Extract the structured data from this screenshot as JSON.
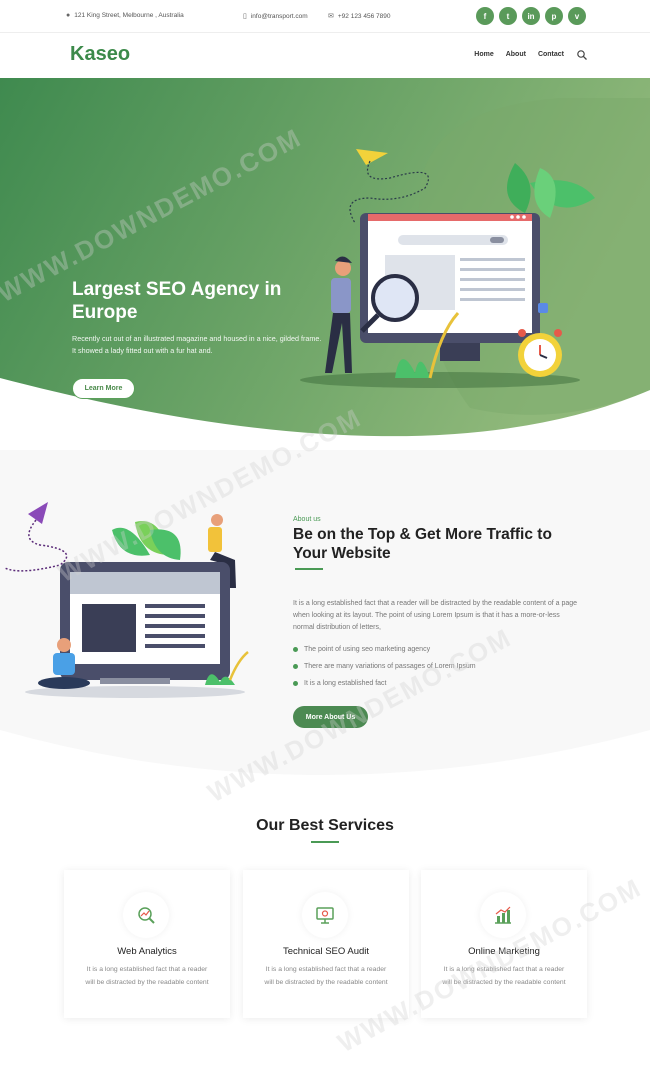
{
  "topbar": {
    "address": "121 King Street, Melbourne , Australia",
    "email": "info@transport.com",
    "phone": "+92 123 456 7890",
    "social": [
      "f",
      "t",
      "in",
      "p",
      "v"
    ]
  },
  "nav": {
    "logo": "Kaseo",
    "items": [
      "Home",
      "About",
      "Contact"
    ]
  },
  "hero": {
    "title": "Largest SEO Agency in Europe",
    "text": "Recently cut out of an illustrated magazine and housed in a nice, gilded frame. It showed a lady fitted out with a fur hat and.",
    "button": "Learn More"
  },
  "about": {
    "label": "About us",
    "title": "Be on the Top & Get More Traffic to Your Website",
    "text": "It is a long established fact that a reader will be distracted by the readable content of a page when looking at its layout. The point of using Lorem Ipsum is that it has a more-or-less normal distribution of letters,",
    "list": [
      "The point of using seo marketing agency",
      "There are many variations of passages of Lorem Ipsum",
      "It is a long established fact"
    ],
    "button": "More About Us"
  },
  "services": {
    "title": "Our Best Services",
    "cards": [
      {
        "title": "Web Analytics",
        "text": "It is a long established fact that a reader will be distracted by the readable content",
        "icon": "analytics-icon"
      },
      {
        "title": "Technical SEO Audit",
        "text": "It is a long established fact that a reader will be distracted by the readable content",
        "icon": "seo-audit-icon"
      },
      {
        "title": "Online Marketing",
        "text": "It is a long established fact that a reader will be distracted by the readable content",
        "icon": "marketing-chart-icon"
      }
    ]
  },
  "watermark": "WWW.DOWNDEMO.COM",
  "colors": {
    "brand": "#3c8a4a",
    "hero_gradient_start": "#3f8a4f",
    "hero_gradient_end": "#8fb87a",
    "button": "#4c8a52"
  }
}
